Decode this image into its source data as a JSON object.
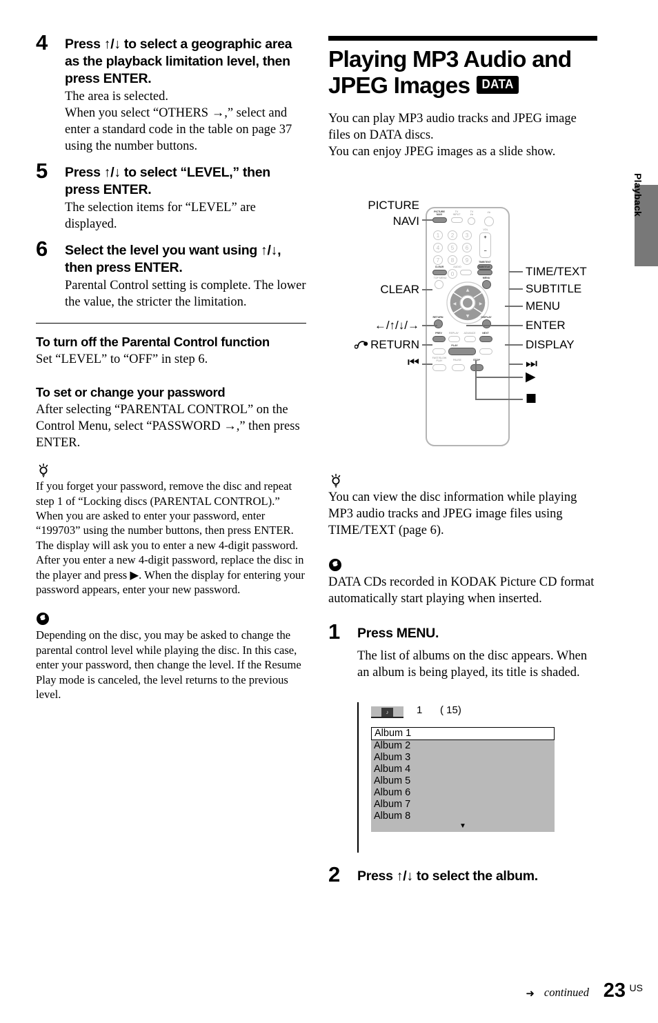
{
  "left_column": {
    "steps": [
      {
        "num": "4",
        "title": "Press ↑/↓ to select a geographic area as the playback limitation level, then press ENTER.",
        "body": "The area is selected.\nWhen you select “OTHERS →,” select and enter a standard code in the table on page 37 using the number buttons."
      },
      {
        "num": "5",
        "title": "Press ↑/↓ to select “LEVEL,” then press ENTER.",
        "body": "The selection items for “LEVEL” are displayed."
      },
      {
        "num": "6",
        "title": "Select the level you want using ↑/↓, then press ENTER.",
        "body": "Parental Control setting is complete. The lower the value, the stricter the limitation."
      }
    ],
    "section_turn_off": {
      "heading": "To turn off the Parental Control function",
      "body": "Set “LEVEL” to “OFF” in step 6."
    },
    "section_password": {
      "heading": "To set or change your password",
      "body": "After selecting “PARENTAL CONTROL” on the Control Menu, select “PASSWORD →,” then press ENTER."
    },
    "tip": {
      "icon": "tip-bulb-icon",
      "text_a": "If you forget your password, remove the disc and repeat step 1 of “Locking discs (PARENTAL CONTROL).” When you are asked to enter your password, enter “199703” using the number buttons, then press ENTER. The display will ask you to enter a new 4-digit password. After you enter a new 4-digit password, replace the disc in the player and press ",
      "play_glyph": "▶",
      "text_b": ". When the display for entering your password appears, enter your new password."
    },
    "note": {
      "icon": "note-icon",
      "text": "Depending on the disc, you may be asked to change the parental control level while playing the disc. In this case, enter your password, then change the level. If the Resume Play mode is canceled, the level returns to the previous level."
    }
  },
  "right_column": {
    "heading_line1": "Playing MP3 Audio and",
    "heading_line2": "JPEG Images",
    "badge": "DATA",
    "intro": "You can play MP3 audio tracks and JPEG image files on DATA discs.\nYou can enjoy JPEG images as a slide show.",
    "tip": {
      "icon": "tip-bulb-icon",
      "text": "You can view the disc information while playing MP3 audio tracks and JPEG image files using TIME/TEXT (page 6)."
    },
    "note": {
      "icon": "note-icon",
      "text": "DATA CDs recorded in KODAK Picture CD format automatically start playing when inserted."
    },
    "steps": [
      {
        "num": "1",
        "title": "Press MENU.",
        "body": "The list of albums on the disc appears. When an album is being played, its title is shaded."
      },
      {
        "num": "2",
        "title": "Press ↑/↓ to select the album.",
        "body": ""
      }
    ]
  },
  "remote": {
    "callouts_left": [
      {
        "line1": "PICTURE",
        "line2": "NAVI"
      },
      {
        "line1": "CLEAR",
        "line2": ""
      },
      {
        "line1": "←/↑/↓/→",
        "line2": ""
      },
      {
        "line1": "RETURN",
        "line2": "",
        "prefix_icon": "return-arrow-icon"
      },
      {
        "line1": "⏮",
        "line2": "",
        "glyph": "prev-icon"
      }
    ],
    "callouts_right": [
      "TIME/TEXT",
      "SUBTITLE",
      "MENU",
      "ENTER",
      "DISPLAY"
    ],
    "callouts_right_glyphs": [
      "next-icon",
      "play-icon",
      "stop-icon"
    ],
    "button_labels": {
      "picture_navi": "PICTURE\nNAVI",
      "tv_input": "TV\nINPUT",
      "tv_power": "TV\nⅠ/⏻",
      "power": "Ⅰ/⏻",
      "vol": "VOL",
      "vol_plus": "+",
      "vol_minus": "−",
      "time_text": "TIME/TEXT",
      "clear": "CLEAR",
      "audio": "AUDIO",
      "subtitle": "SUBTITLE",
      "top_menu": "TOP MENU",
      "menu": "MENU",
      "return": "RETURN",
      "display": "DISPLAY",
      "prev": "PREV",
      "replay": "REPLAY",
      "advance": "ADVANCE",
      "next": "NEXT",
      "fast_slow_play": "FAST/SLOW\nPLAY",
      "play": "PLAY",
      "pause": "PAUSE",
      "stop": "STOP"
    },
    "numpad": [
      "1",
      "2",
      "3",
      "4",
      "5",
      "6",
      "7",
      "8",
      "9",
      "0"
    ]
  },
  "album_screen": {
    "icon": "album-disc-icon",
    "current": "1",
    "total": "( 15)",
    "items": [
      "Album 1",
      "Album 2",
      "Album 3",
      "Album 4",
      "Album 5",
      "Album 6",
      "Album 7",
      "Album 8"
    ],
    "selected_index": 0,
    "more_indicator": "▼"
  },
  "side_tab": {
    "label": "Playback"
  },
  "footer": {
    "arrow": "➜",
    "continued": "continued",
    "page": "23",
    "page_suffix": "US"
  },
  "colors": {
    "grey_tab": "#787878",
    "screen_grey": "#b9b9b9",
    "button_dark": "#8c8c8c",
    "remote_outline": "#b4b4b4"
  }
}
